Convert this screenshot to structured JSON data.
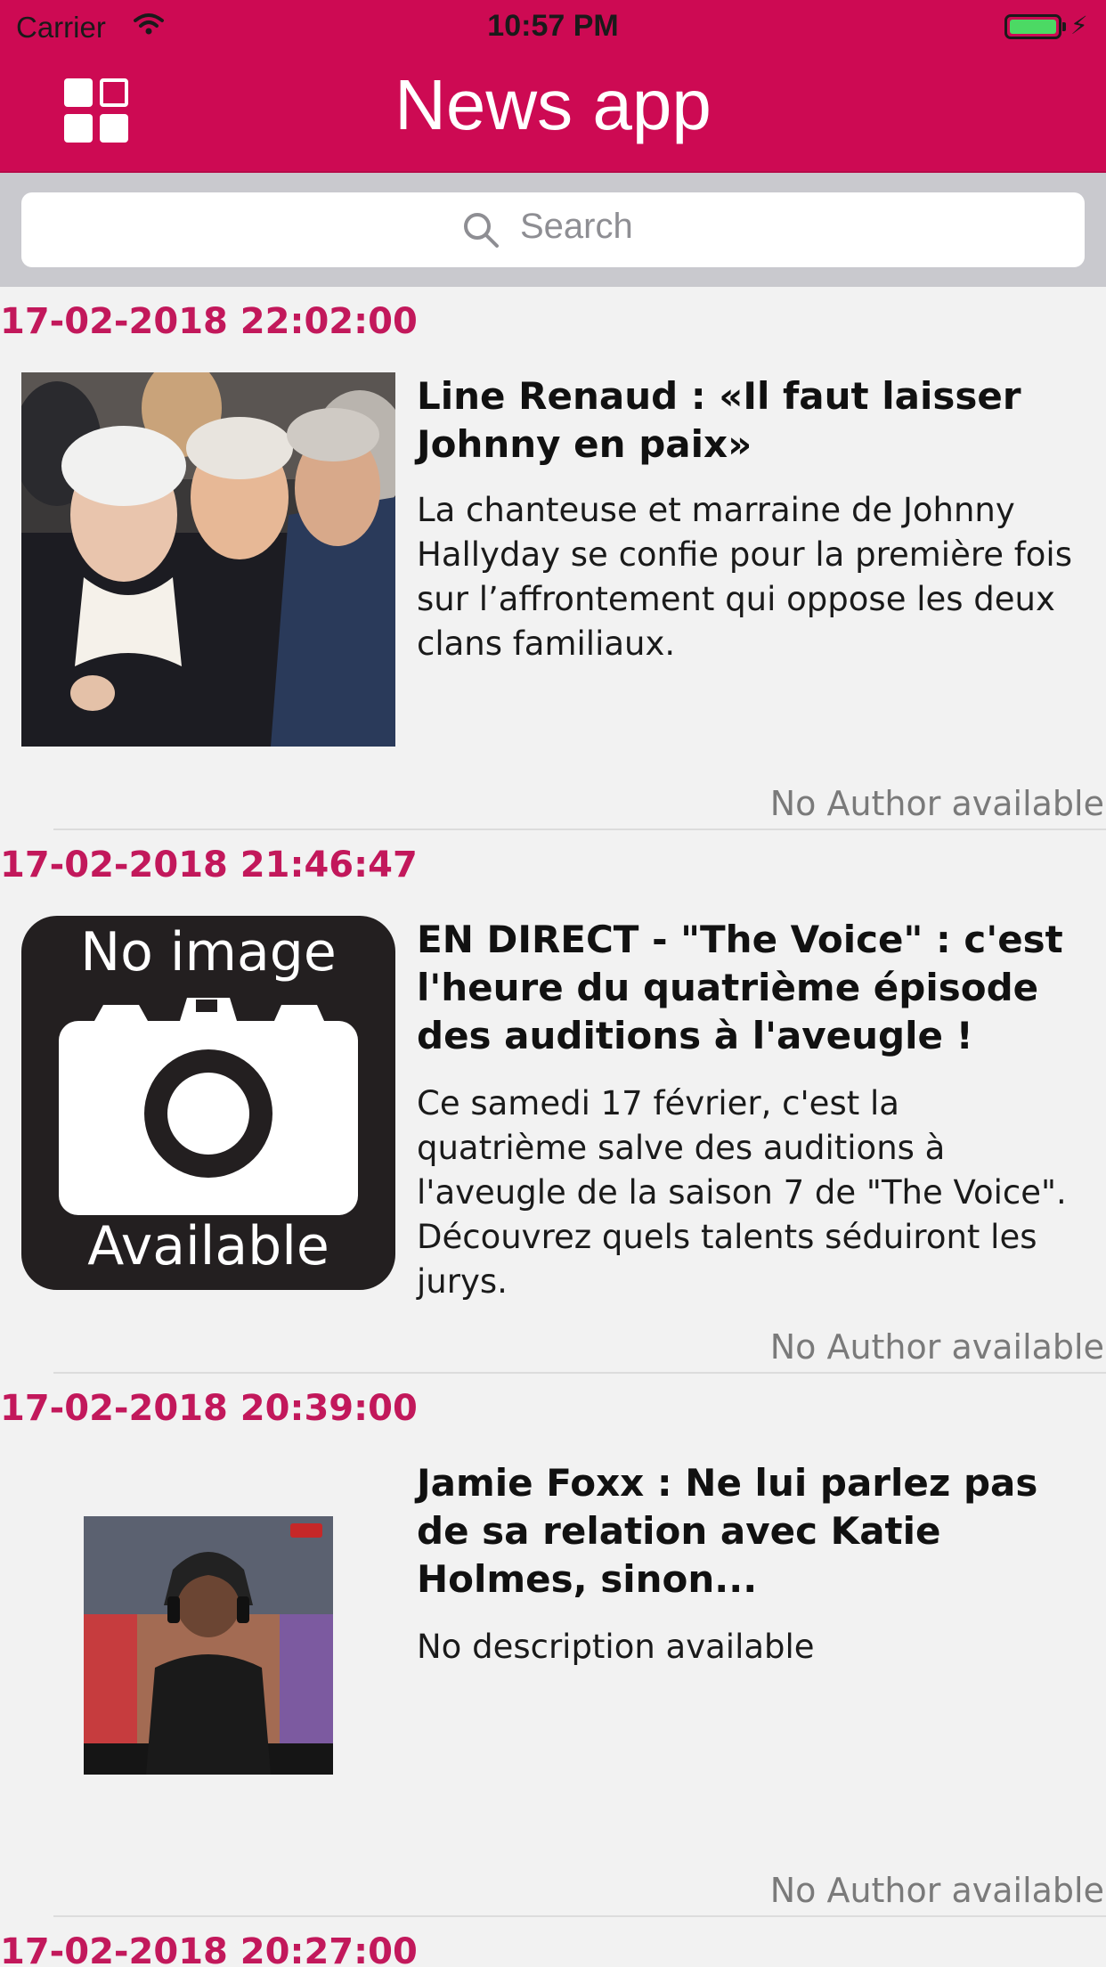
{
  "status_bar": {
    "carrier": "Carrier",
    "time": "10:57 PM",
    "battery_color": "#4cd964"
  },
  "nav": {
    "title": "News app",
    "menu_icon": "grid-icon",
    "background": "#cd0a53"
  },
  "search": {
    "placeholder": "Search",
    "icon": "search-icon"
  },
  "articles": [
    {
      "date": "17-02-2018 22:02:00",
      "title": "Line Renaud : «Il faut laisser Johnny en paix»",
      "description": "La chanteuse et marraine de Johnny Hallyday se confie pour la première fois sur l’affrontement qui oppose les deux clans familiaux.",
      "author": "No Author available",
      "image": "photo"
    },
    {
      "date": "17-02-2018 21:46:47",
      "title": "EN DIRECT - \"The Voice\" : c'est l'heure du quatrième épisode des auditions à l'aveugle !",
      "description": "Ce samedi 17 février, c'est la quatrième salve des auditions à l'aveugle de la saison 7 de \"The Voice\". Découvrez quels talents séduiront les jurys.",
      "author": "No Author available",
      "image": "placeholder",
      "placeholder_top": "No image",
      "placeholder_bottom": "Available"
    },
    {
      "date": "17-02-2018 20:39:00",
      "title": "Jamie Foxx : Ne lui parlez pas de sa relation avec Katie Holmes, sinon...",
      "description": "No description available",
      "author": "No Author available",
      "image": "photo"
    },
    {
      "date": "17-02-2018 20:27:00"
    }
  ],
  "colors": {
    "accent": "#cd0a53",
    "date": "#c2185b"
  }
}
